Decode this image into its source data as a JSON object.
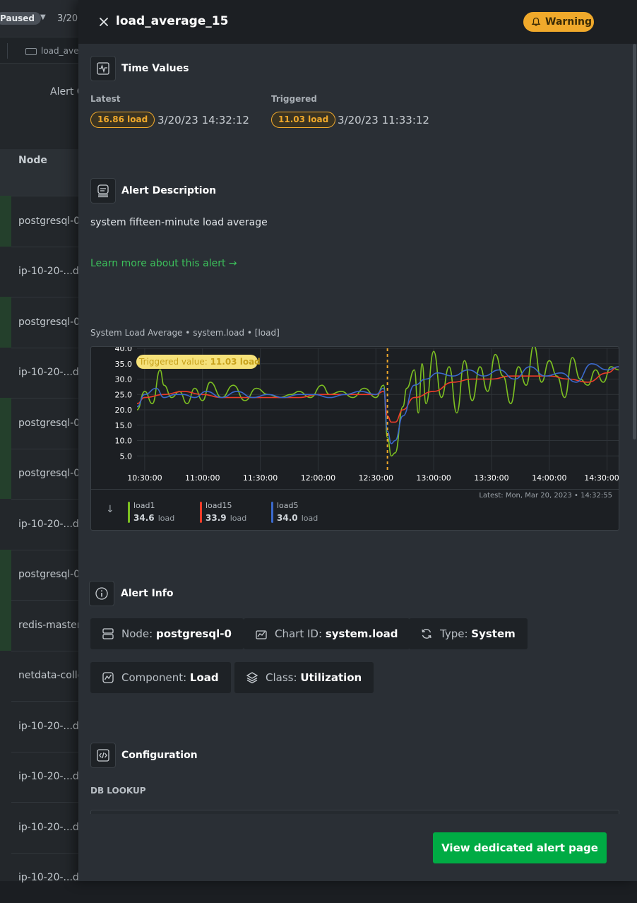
{
  "background": {
    "paused_label": "Paused",
    "date_text": "3/20,",
    "tab_label": "load_ave",
    "alert_label": "Alert C",
    "table_header_node": "Node",
    "rows": [
      "postgresql-0",
      "ip-10-20-...d",
      "postgresql-0",
      "ip-10-20-...d",
      "postgresql-0",
      "postgresql-0",
      "ip-10-20-...d",
      "postgresql-0",
      "redis-master",
      "netdata-colle",
      "ip-10-20-...d",
      "ip-10-20-...d",
      "ip-10-20-...d",
      "ip-10-20-...d"
    ]
  },
  "drawer": {
    "title": "load_average_15",
    "status_badge": "Warning",
    "status_color": "#f0a92b"
  },
  "time_values": {
    "section_title": "Time Values",
    "latest_label": "Latest",
    "latest_value": "16.86 load",
    "latest_time": "3/20/23 14:32:12",
    "triggered_label": "Triggered",
    "triggered_value": "11.03 load",
    "triggered_time": "3/20/23 11:33:12"
  },
  "description": {
    "section_title": "Alert Description",
    "text": "system fifteen-minute load average",
    "learn_more": "Learn more about this alert →"
  },
  "chart_header": {
    "title": "System Load Average",
    "context": "system.load",
    "units": "[load]"
  },
  "chart_data": {
    "type": "line",
    "ylim": [
      0,
      40
    ],
    "yticks": [
      "40.0",
      "35.0",
      "30.0",
      "25.0",
      "20.0",
      "15.0",
      "10.0",
      "5.0"
    ],
    "xticks": [
      "10:30:00",
      "11:00:00",
      "11:30:00",
      "12:00:00",
      "12:30:00",
      "13:00:00",
      "13:30:00",
      "14:00:00",
      "14:30:00"
    ],
    "x_range_minutes": [
      -2,
      123
    ],
    "trigger_minute": 63,
    "trigger_label": "Triggered value:",
    "trigger_value": "11.03 load",
    "series": [
      {
        "name": "load1",
        "color": "#7cbf21",
        "latest": "34.6",
        "anchors": [
          [
            -2,
            20
          ],
          [
            0,
            26
          ],
          [
            2,
            22
          ],
          [
            4,
            33
          ],
          [
            5,
            28
          ],
          [
            7,
            24
          ],
          [
            9,
            26
          ],
          [
            11,
            22
          ],
          [
            13,
            27
          ],
          [
            15,
            23
          ],
          [
            17,
            29
          ],
          [
            20,
            24
          ],
          [
            23,
            28
          ],
          [
            26,
            23
          ],
          [
            29,
            27
          ],
          [
            32,
            25
          ],
          [
            35,
            24
          ],
          [
            38,
            25
          ],
          [
            40,
            26
          ],
          [
            43,
            24
          ],
          [
            46,
            28
          ],
          [
            48,
            25
          ],
          [
            51,
            26
          ],
          [
            54,
            24
          ],
          [
            57,
            27
          ],
          [
            60,
            24
          ],
          [
            62,
            28
          ],
          [
            63,
            11
          ],
          [
            64,
            5
          ],
          [
            65,
            6
          ],
          [
            67,
            21
          ],
          [
            68,
            27
          ],
          [
            70,
            33
          ],
          [
            71,
            19
          ],
          [
            72,
            35
          ],
          [
            73,
            22
          ],
          [
            75,
            39
          ],
          [
            77,
            24
          ],
          [
            79,
            34
          ],
          [
            81,
            19
          ],
          [
            83,
            36
          ],
          [
            85,
            23
          ],
          [
            87,
            34
          ],
          [
            89,
            26
          ],
          [
            91,
            38
          ],
          [
            93,
            31
          ],
          [
            95,
            22
          ],
          [
            97,
            34
          ],
          [
            99,
            28
          ],
          [
            101,
            41
          ],
          [
            103,
            29
          ],
          [
            105,
            36
          ],
          [
            107,
            31
          ],
          [
            109,
            24
          ],
          [
            111,
            37
          ],
          [
            113,
            30
          ],
          [
            115,
            28
          ],
          [
            117,
            33
          ],
          [
            119,
            29
          ],
          [
            121,
            34
          ],
          [
            123,
            33
          ]
        ]
      },
      {
        "name": "load15",
        "color": "#ee3c29",
        "latest": "33.9",
        "anchors": [
          [
            -2,
            22
          ],
          [
            0,
            24
          ],
          [
            5,
            25
          ],
          [
            10,
            26
          ],
          [
            15,
            25
          ],
          [
            20,
            24
          ],
          [
            25,
            24
          ],
          [
            30,
            24
          ],
          [
            35,
            24
          ],
          [
            40,
            24
          ],
          [
            45,
            25
          ],
          [
            50,
            25
          ],
          [
            55,
            25
          ],
          [
            60,
            25
          ],
          [
            62,
            26
          ],
          [
            63,
            18
          ],
          [
            64,
            16
          ],
          [
            65,
            16
          ],
          [
            67,
            20
          ],
          [
            70,
            24
          ],
          [
            75,
            26
          ],
          [
            80,
            29
          ],
          [
            85,
            30
          ],
          [
            90,
            30
          ],
          [
            95,
            31
          ],
          [
            100,
            31
          ],
          [
            105,
            31
          ],
          [
            110,
            30
          ],
          [
            115,
            29
          ],
          [
            120,
            32
          ],
          [
            123,
            34
          ]
        ]
      },
      {
        "name": "load5",
        "color": "#3b69cc",
        "latest": "34.0",
        "anchors": [
          [
            -2,
            21
          ],
          [
            0,
            25
          ],
          [
            3,
            27
          ],
          [
            5,
            24
          ],
          [
            8,
            25
          ],
          [
            10,
            25
          ],
          [
            13,
            24
          ],
          [
            16,
            26
          ],
          [
            20,
            24
          ],
          [
            24,
            26
          ],
          [
            28,
            24
          ],
          [
            32,
            25
          ],
          [
            36,
            24
          ],
          [
            40,
            25
          ],
          [
            44,
            25
          ],
          [
            48,
            24
          ],
          [
            52,
            25
          ],
          [
            56,
            26
          ],
          [
            60,
            25
          ],
          [
            62,
            27
          ],
          [
            63,
            13
          ],
          [
            64,
            9
          ],
          [
            65,
            10
          ],
          [
            67,
            18
          ],
          [
            70,
            28
          ],
          [
            73,
            30
          ],
          [
            76,
            32
          ],
          [
            80,
            31
          ],
          [
            84,
            33
          ],
          [
            88,
            31
          ],
          [
            92,
            33
          ],
          [
            96,
            30
          ],
          [
            100,
            34
          ],
          [
            104,
            31
          ],
          [
            108,
            32
          ],
          [
            112,
            29
          ],
          [
            116,
            35
          ],
          [
            120,
            33
          ],
          [
            123,
            34
          ]
        ]
      }
    ],
    "unit": "load",
    "latest_label": "Latest:",
    "latest_timestamp": "Mon, Mar 20, 2023 • 14:32:55"
  },
  "alert_info": {
    "section_title": "Alert Info",
    "chips": [
      {
        "label": "Node:",
        "value": "postgresql-0"
      },
      {
        "label": "Chart ID:",
        "value": "system.load"
      },
      {
        "label": "Type:",
        "value": "System"
      },
      {
        "label": "Component:",
        "value": "Load"
      },
      {
        "label": "Class:",
        "value": "Utilization"
      }
    ]
  },
  "configuration": {
    "section_title": "Configuration",
    "db_lookup_label": "DB LOOKUP"
  },
  "footer": {
    "cta_label": "View dedicated alert page",
    "cta_color": "#00ab44"
  }
}
